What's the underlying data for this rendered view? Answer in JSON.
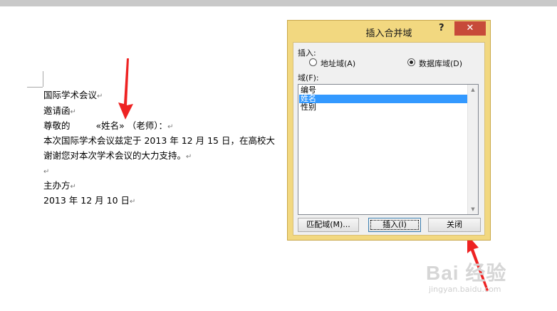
{
  "document": {
    "lines": [
      "国际学术会议",
      "邀请函",
      "尊敬的",
      "«姓名»",
      "（老师）：",
      "本次国际学术会议兹定于 2013 年 12 月 15 日，在高校大",
      "谢谢您对本次学术会议的大力支持。",
      "主办方",
      "2013 年 12 月 10 日"
    ],
    "paragraph_mark": "↵"
  },
  "dialog": {
    "title": "插入合并域",
    "help": "?",
    "close": "✕",
    "insert_label": "插入:",
    "radio_address": "地址域(A)",
    "radio_database": "数据库域(D)",
    "selected_radio": "数据库域(D)",
    "fields_label": "域(F):",
    "fields": [
      "编号",
      "姓名",
      "性别"
    ],
    "selected_field": "姓名",
    "buttons": {
      "match": "匹配域(M)...",
      "insert": "插入(I)",
      "close": "关闭"
    }
  },
  "scrollbar": {
    "up": "▲",
    "down": "▼"
  },
  "watermark": {
    "main": "Bai 经验",
    "sub": "jingyan.baidu.com"
  },
  "colors": {
    "dialog_frame": "#f2d880",
    "selection": "#3399ff",
    "close_button": "#c74a39",
    "arrow": "#ee2222"
  }
}
